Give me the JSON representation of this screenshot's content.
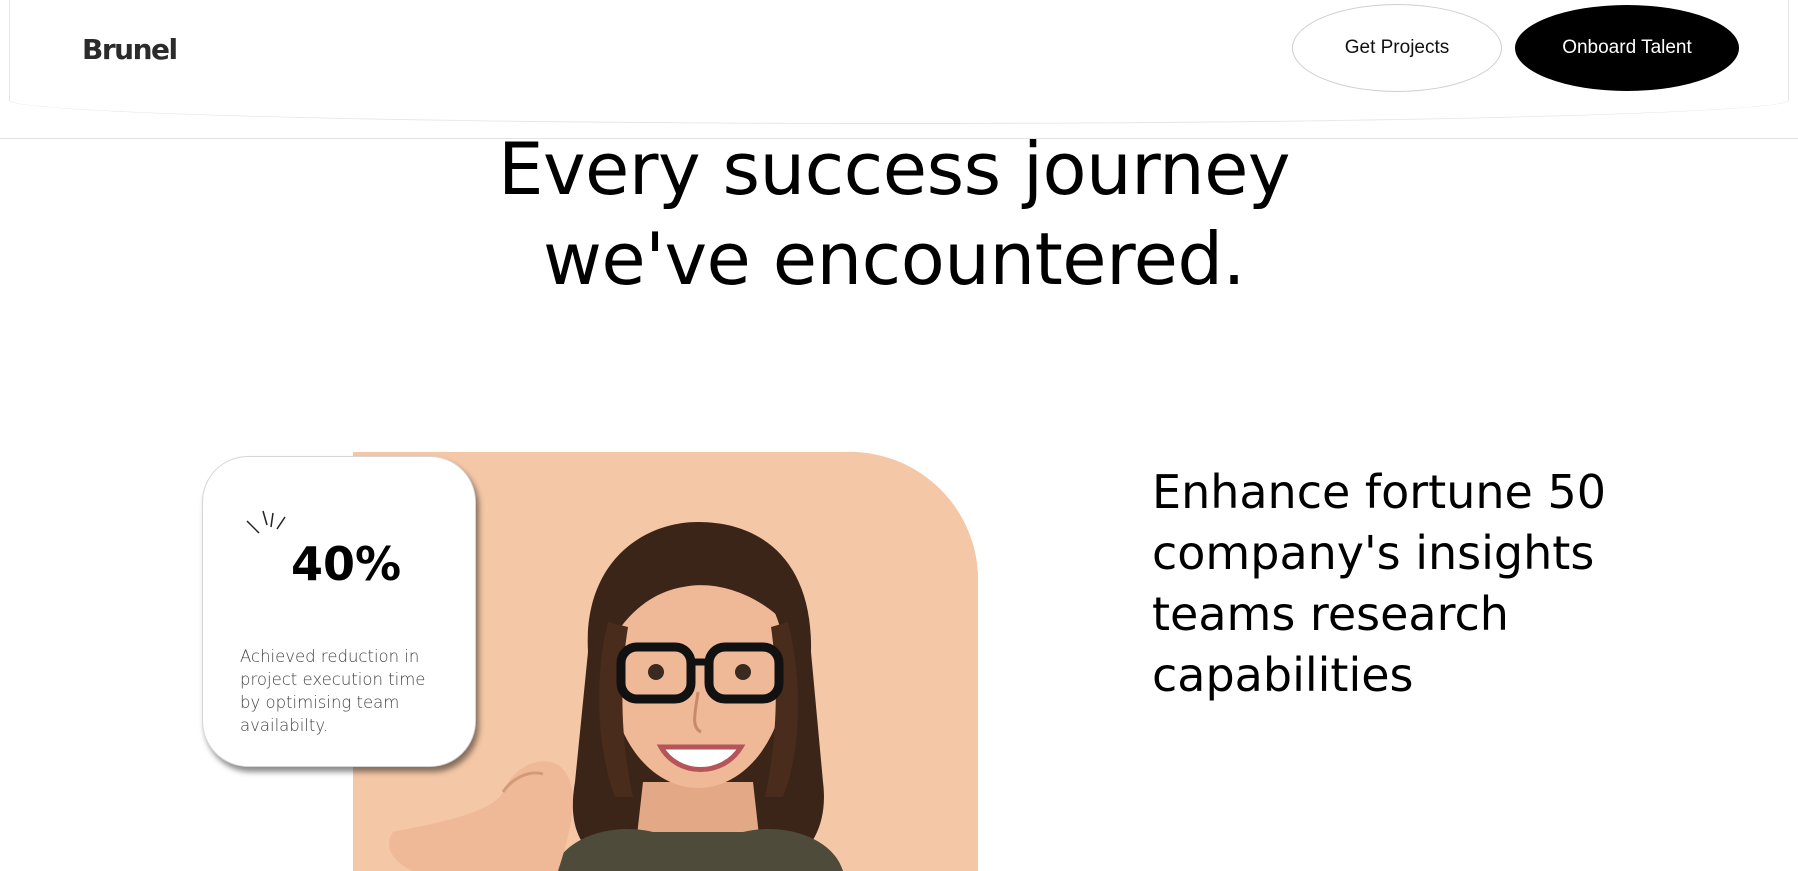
{
  "header": {
    "logo_text": "Brunel",
    "get_projects_label": "Get Projects",
    "onboard_talent_label": "Onboard Talent"
  },
  "hero": {
    "line1": "Every success journey",
    "line2": "we've encountered."
  },
  "case_study": {
    "stat_value": "40%",
    "stat_description": "Achieved reduction in project execution time by optimising team availabilty.",
    "title": "Enhance fortune 50 company's insights teams research capabilities"
  },
  "colors": {
    "photo_background": "#f4c7a6",
    "solid_button": "#000000"
  }
}
